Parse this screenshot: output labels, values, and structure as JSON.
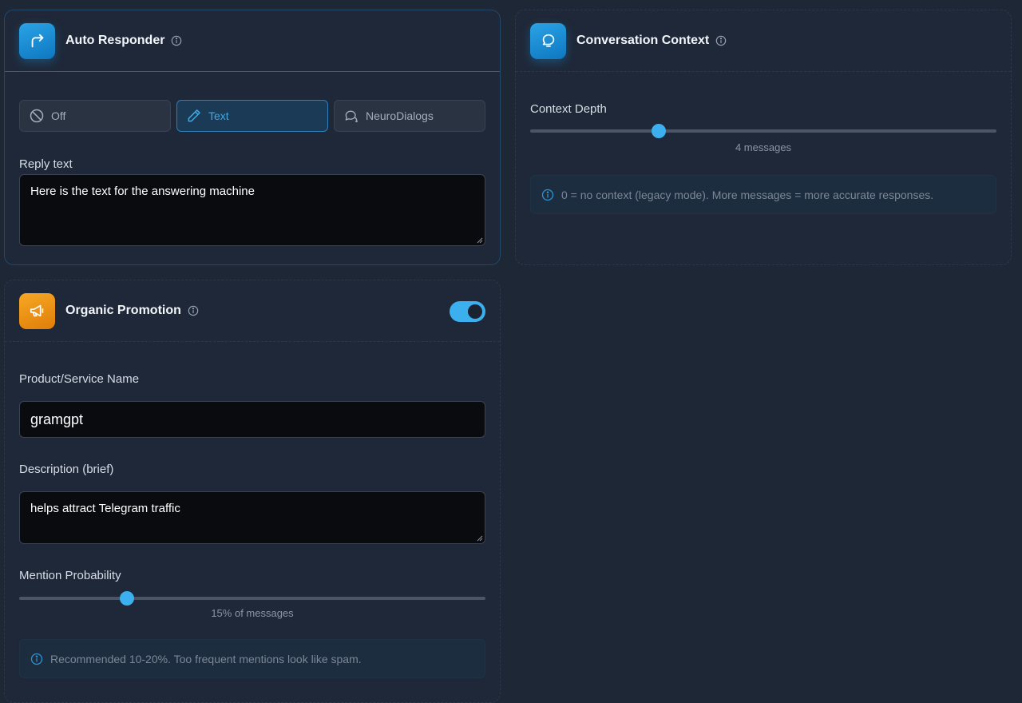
{
  "auto_responder": {
    "title": "Auto Responder",
    "modes": [
      {
        "label": "Off",
        "icon": "ban-icon",
        "selected": false
      },
      {
        "label": "Text",
        "icon": "pencil-icon",
        "selected": true
      },
      {
        "label": "NeuroDialogs",
        "icon": "chat-bubbles-icon",
        "selected": false
      }
    ],
    "reply_label": "Reply text",
    "reply_value": "Here is the text for the answering machine"
  },
  "conversation_context": {
    "title": "Conversation Context",
    "depth_label": "Context Depth",
    "depth_value": 4,
    "depth_caption": "4 messages",
    "note": "0 = no context (legacy mode). More messages = more accurate responses."
  },
  "organic_promotion": {
    "title": "Organic Promotion",
    "enabled": true,
    "product_label": "Product/Service Name",
    "product_value": "gramgpt",
    "description_label": "Description (brief)",
    "description_value": "helps attract Telegram traffic",
    "probability_label": "Mention Probability",
    "probability_percent": 15,
    "probability_caption": "15% of messages",
    "note": "Recommended 10-20%. Too frequent mentions look like spam."
  },
  "colors": {
    "accent": "#3cb0ee",
    "background": "#1e2736",
    "orange": "#f39a1a"
  }
}
